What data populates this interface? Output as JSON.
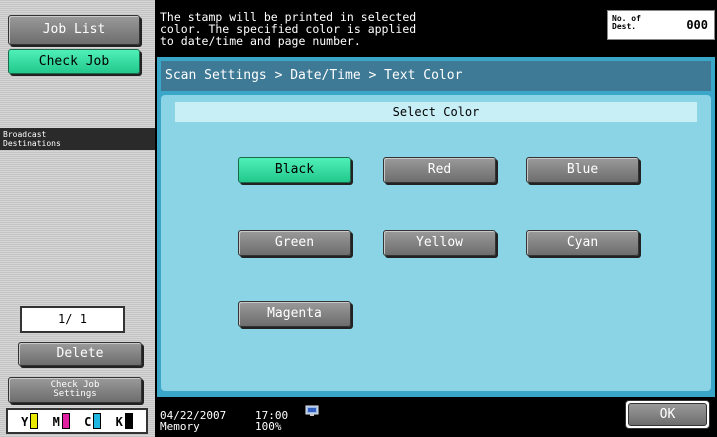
{
  "left": {
    "job_list": "Job List",
    "check_job": "Check Job",
    "broadcast_line1": "Broadcast",
    "broadcast_line2": "Destinations",
    "counter": "1/ 1",
    "delete": "Delete",
    "check_job_settings_line1": "Check Job",
    "check_job_settings_line2": "Settings",
    "toner": [
      {
        "letter": "Y",
        "color": "#e8e800"
      },
      {
        "letter": "M",
        "color": "#e020a0"
      },
      {
        "letter": "C",
        "color": "#20b8e0"
      },
      {
        "letter": "K",
        "color": "#000000"
      }
    ]
  },
  "header": {
    "message_line1": "The stamp will be printed in selected",
    "message_line2": "color. The specified color is applied",
    "message_line3": "to date/time and page number.",
    "dest_label_line1": "No. of",
    "dest_label_line2": "Dest.",
    "dest_value": "000"
  },
  "main": {
    "breadcrumb": "Scan Settings > Date/Time > Text Color",
    "select_header": "Select Color",
    "colors": {
      "black": "Black",
      "red": "Red",
      "blue": "Blue",
      "green": "Green",
      "yellow": "Yellow",
      "cyan": "Cyan",
      "magenta": "Magenta"
    },
    "selected": "Black"
  },
  "footer": {
    "date": "04/22/2007",
    "time": "17:00",
    "memory_label": "Memory",
    "memory_value": "100%",
    "ok": "OK"
  },
  "theme": {
    "accent_green": "#2ed89c",
    "panel_blue": "#3aa6c8",
    "breadcrumb_blue": "#3e7a96"
  }
}
